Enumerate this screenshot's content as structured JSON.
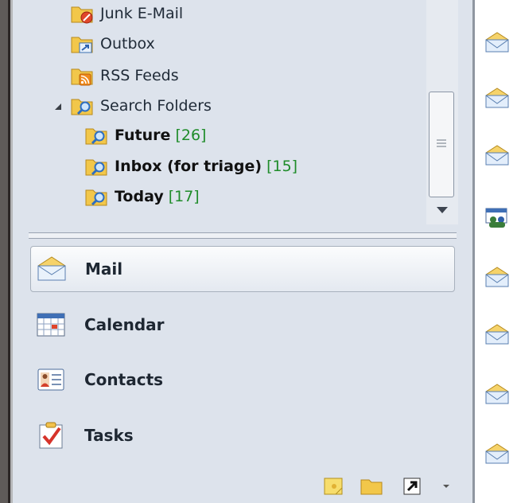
{
  "folders": [
    {
      "label": "Junk E-Mail",
      "icon": "junk-folder-icon"
    },
    {
      "label": "Outbox",
      "icon": "outbox-folder-icon"
    },
    {
      "label": "RSS Feeds",
      "icon": "rss-folder-icon"
    },
    {
      "label": "Search Folders",
      "icon": "search-folder-icon",
      "expanded": true
    }
  ],
  "search_folders": [
    {
      "label": "Future",
      "count": "[26]"
    },
    {
      "label": "Inbox (for triage)",
      "count": "[15]"
    },
    {
      "label": "Today",
      "count": "[17]"
    }
  ],
  "nav": {
    "mail": "Mail",
    "calendar": "Calendar",
    "contacts": "Contacts",
    "tasks": "Tasks"
  },
  "colors": {
    "pane_bg": "#dde3ec",
    "count_green": "#1f8c2a",
    "folder_yellow": "#f2c74a"
  }
}
